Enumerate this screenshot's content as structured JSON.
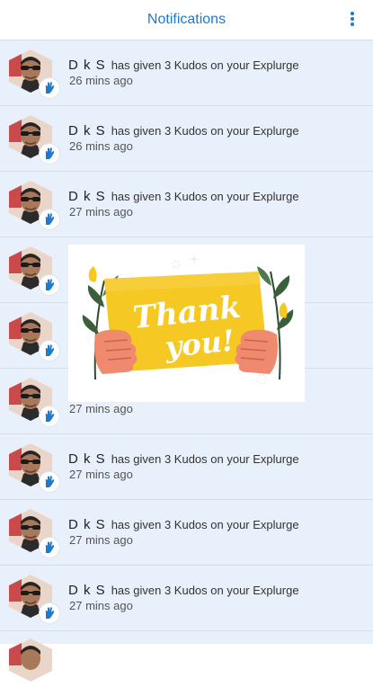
{
  "header": {
    "title": "Notifications",
    "menu_icon": "kebab-menu-icon"
  },
  "colors": {
    "accent": "#1f7ac9",
    "row_bg": "#e8f0fb",
    "popup_yellow": "#f6c824"
  },
  "notifications": [
    {
      "name": "D k S",
      "message": "has given 3 Kudos on your Explurge",
      "time": "26 mins ago"
    },
    {
      "name": "D k S",
      "message": "has given 3 Kudos on your Explurge",
      "time": "26 mins ago"
    },
    {
      "name": "D k S",
      "message": "has given 3 Kudos on your Explurge",
      "time": "27 mins ago"
    },
    {
      "name": "",
      "message": "",
      "time": ""
    },
    {
      "name": "",
      "message": "",
      "time": ""
    },
    {
      "name": "",
      "message": "",
      "time": "27 mins ago"
    },
    {
      "name": "D k S",
      "message": "has given 3 Kudos on your Explurge",
      "time": "27 mins ago"
    },
    {
      "name": "D k S",
      "message": "has given 3 Kudos on your Explurge",
      "time": "27 mins ago"
    },
    {
      "name": "D k S",
      "message": "has given 3 Kudos on your Explurge",
      "time": "27 mins ago"
    }
  ],
  "popup": {
    "line1": "Thank",
    "line2": "you!"
  }
}
